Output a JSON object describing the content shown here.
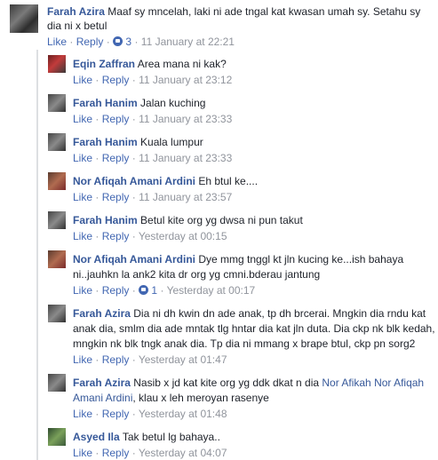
{
  "top_comment": {
    "author": "Farah Azira",
    "text": "Maaf sy mncelah, laki ni ade tngal kat kwasan umah sy. Setahu sy dia ni x betul",
    "like_label": "Like",
    "reply_label": "Reply",
    "reaction_count": "3",
    "timestamp": "11 January at 22:21"
  },
  "replies": [
    {
      "author": "Eqin Zaffran",
      "text": "Area mana ni kak?",
      "like_label": "Like",
      "reply_label": "Reply",
      "timestamp": "11 January at 23:12"
    },
    {
      "author": "Farah Hanim",
      "text": "Jalan kuching",
      "like_label": "Like",
      "reply_label": "Reply",
      "timestamp": "11 January at 23:33"
    },
    {
      "author": "Farah Hanim",
      "text": "Kuala lumpur",
      "like_label": "Like",
      "reply_label": "Reply",
      "timestamp": "11 January at 23:33"
    },
    {
      "author": "Nor Afiqah Amani Ardini",
      "text": "Eh btul ke....",
      "like_label": "Like",
      "reply_label": "Reply",
      "timestamp": "11 January at 23:57"
    },
    {
      "author": "Farah Hanim",
      "text": "Betul kite org yg dwsa ni pun takut",
      "like_label": "Like",
      "reply_label": "Reply",
      "timestamp": "Yesterday at 00:15"
    },
    {
      "author": "Nor Afiqah Amani Ardini",
      "text": "Dye mmg tnggl kt jln kucing ke...ish bahaya ni..jauhkn la ank2 kita dr org yg cmni.bderau jantung",
      "like_label": "Like",
      "reply_label": "Reply",
      "reaction_count": "1",
      "timestamp": "Yesterday at 00:17"
    },
    {
      "author": "Farah Azira",
      "text": "Dia ni dh kwin dn ade anak, tp dh brcerai. Mngkin dia rndu kat anak dia, smlm dia ade mntak tlg hntar dia kat jln duta. Dia ckp nk blk kedah, mngkin nk blk tngk anak dia. Tp dia ni mmang x brape btul, ckp pn sorg2",
      "like_label": "Like",
      "reply_label": "Reply",
      "timestamp": "Yesterday at 01:47"
    },
    {
      "author": "Farah Azira",
      "text_before": "Nasib x jd kat kite org yg ddk dkat n dia ",
      "mention": "Nor Afikah Nor Afiqah Amani Ardini",
      "text_after": ", klau x leh meroyan rasenye",
      "like_label": "Like",
      "reply_label": "Reply",
      "timestamp": "Yesterday at 01:48"
    },
    {
      "author": "Asyed Ila",
      "text": "Tak betul lg bahaya..",
      "like_label": "Like",
      "reply_label": "Reply",
      "timestamp": "Yesterday at 04:07"
    }
  ],
  "colors": {
    "link": "#365899",
    "action": "#4267b2",
    "meta": "#90949c",
    "text": "#1d2129",
    "thread_line": "#dddfe2"
  }
}
